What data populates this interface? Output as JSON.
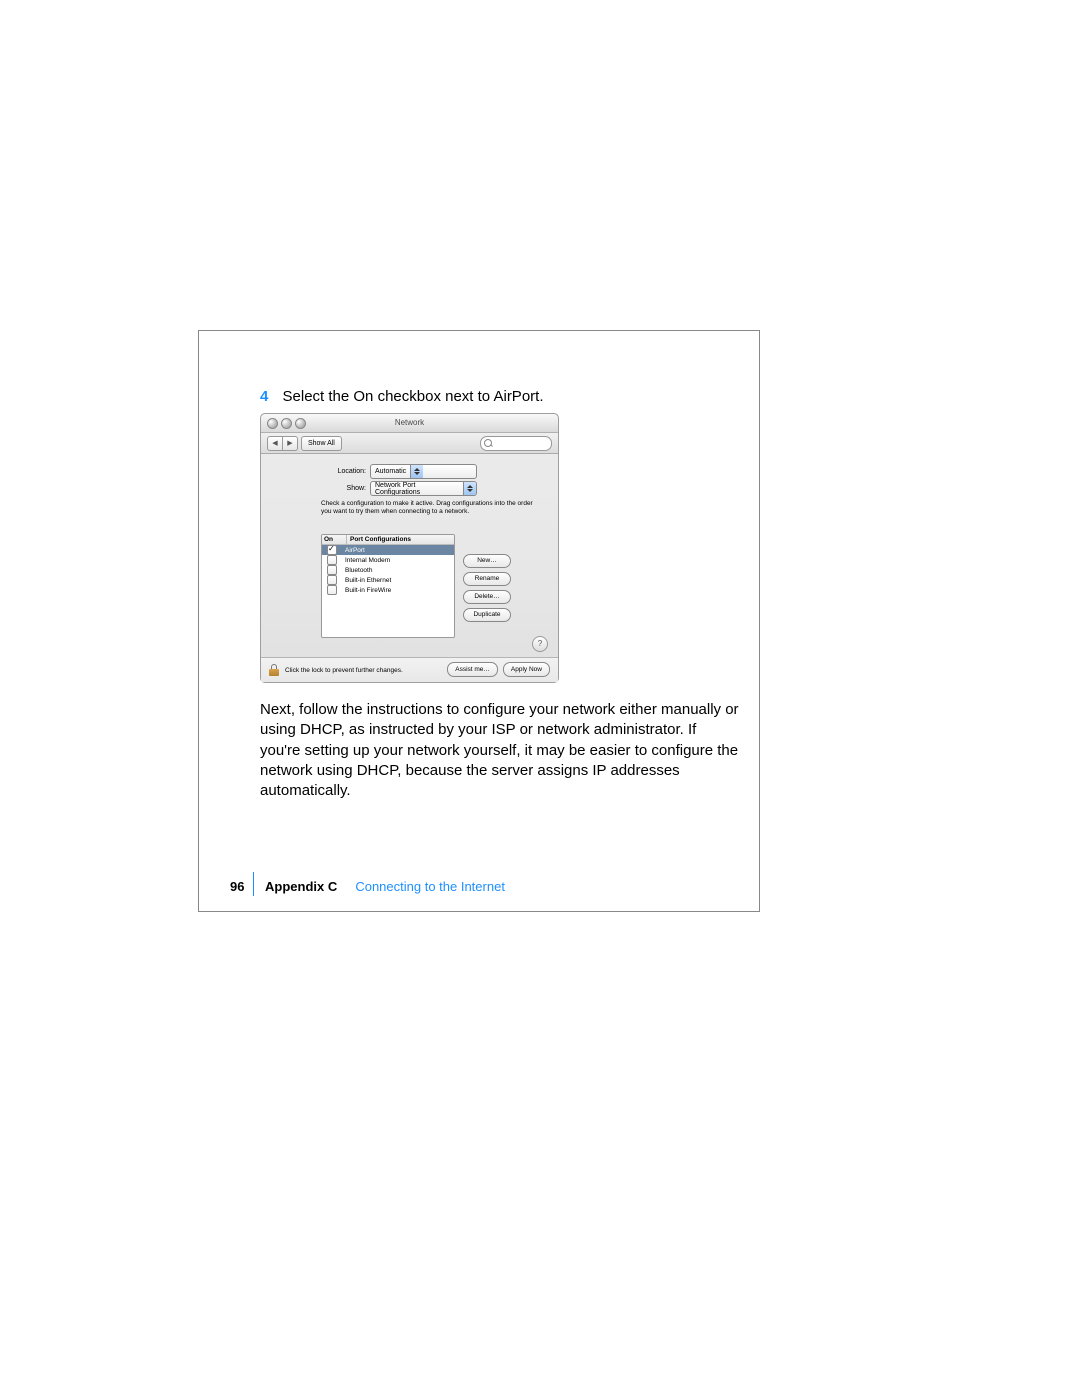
{
  "step": {
    "number": "4",
    "text": "Select the On checkbox next to AirPort."
  },
  "paragraph": "Next, follow the instructions to configure your network either manually or using DHCP, as instructed by your ISP or network administrator. If you're setting up your network yourself, it may be easier to configure the network using DHCP, because the server assigns IP addresses automatically.",
  "footer": {
    "page": "96",
    "appendix": "Appendix C",
    "title": "Connecting to the Internet"
  },
  "mac": {
    "title": "Network",
    "toolbar": {
      "back": "◀",
      "forward": "▶",
      "show_all": "Show All",
      "search_placeholder": ""
    },
    "location": {
      "label": "Location:",
      "value": "Automatic"
    },
    "show": {
      "label": "Show:",
      "value": "Network Port Configurations"
    },
    "hint": "Check a configuration to make it active.\nDrag configurations into the order you want to try them when connecting to a network.",
    "list": {
      "headers": {
        "on": "On",
        "name": "Port Configurations"
      },
      "rows": [
        {
          "on": true,
          "name": "AirPort",
          "selected": true
        },
        {
          "on": false,
          "name": "Internal Modem",
          "selected": false
        },
        {
          "on": false,
          "name": "Bluetooth",
          "selected": false
        },
        {
          "on": false,
          "name": "Built-in Ethernet",
          "selected": false
        },
        {
          "on": false,
          "name": "Built-in FireWire",
          "selected": false
        }
      ]
    },
    "side_buttons": [
      "New…",
      "Rename",
      "Delete…",
      "Duplicate"
    ],
    "help": "?",
    "lock_text": "Click the lock to prevent further changes.",
    "bottom_buttons": [
      "Assist me…",
      "Apply Now"
    ]
  }
}
